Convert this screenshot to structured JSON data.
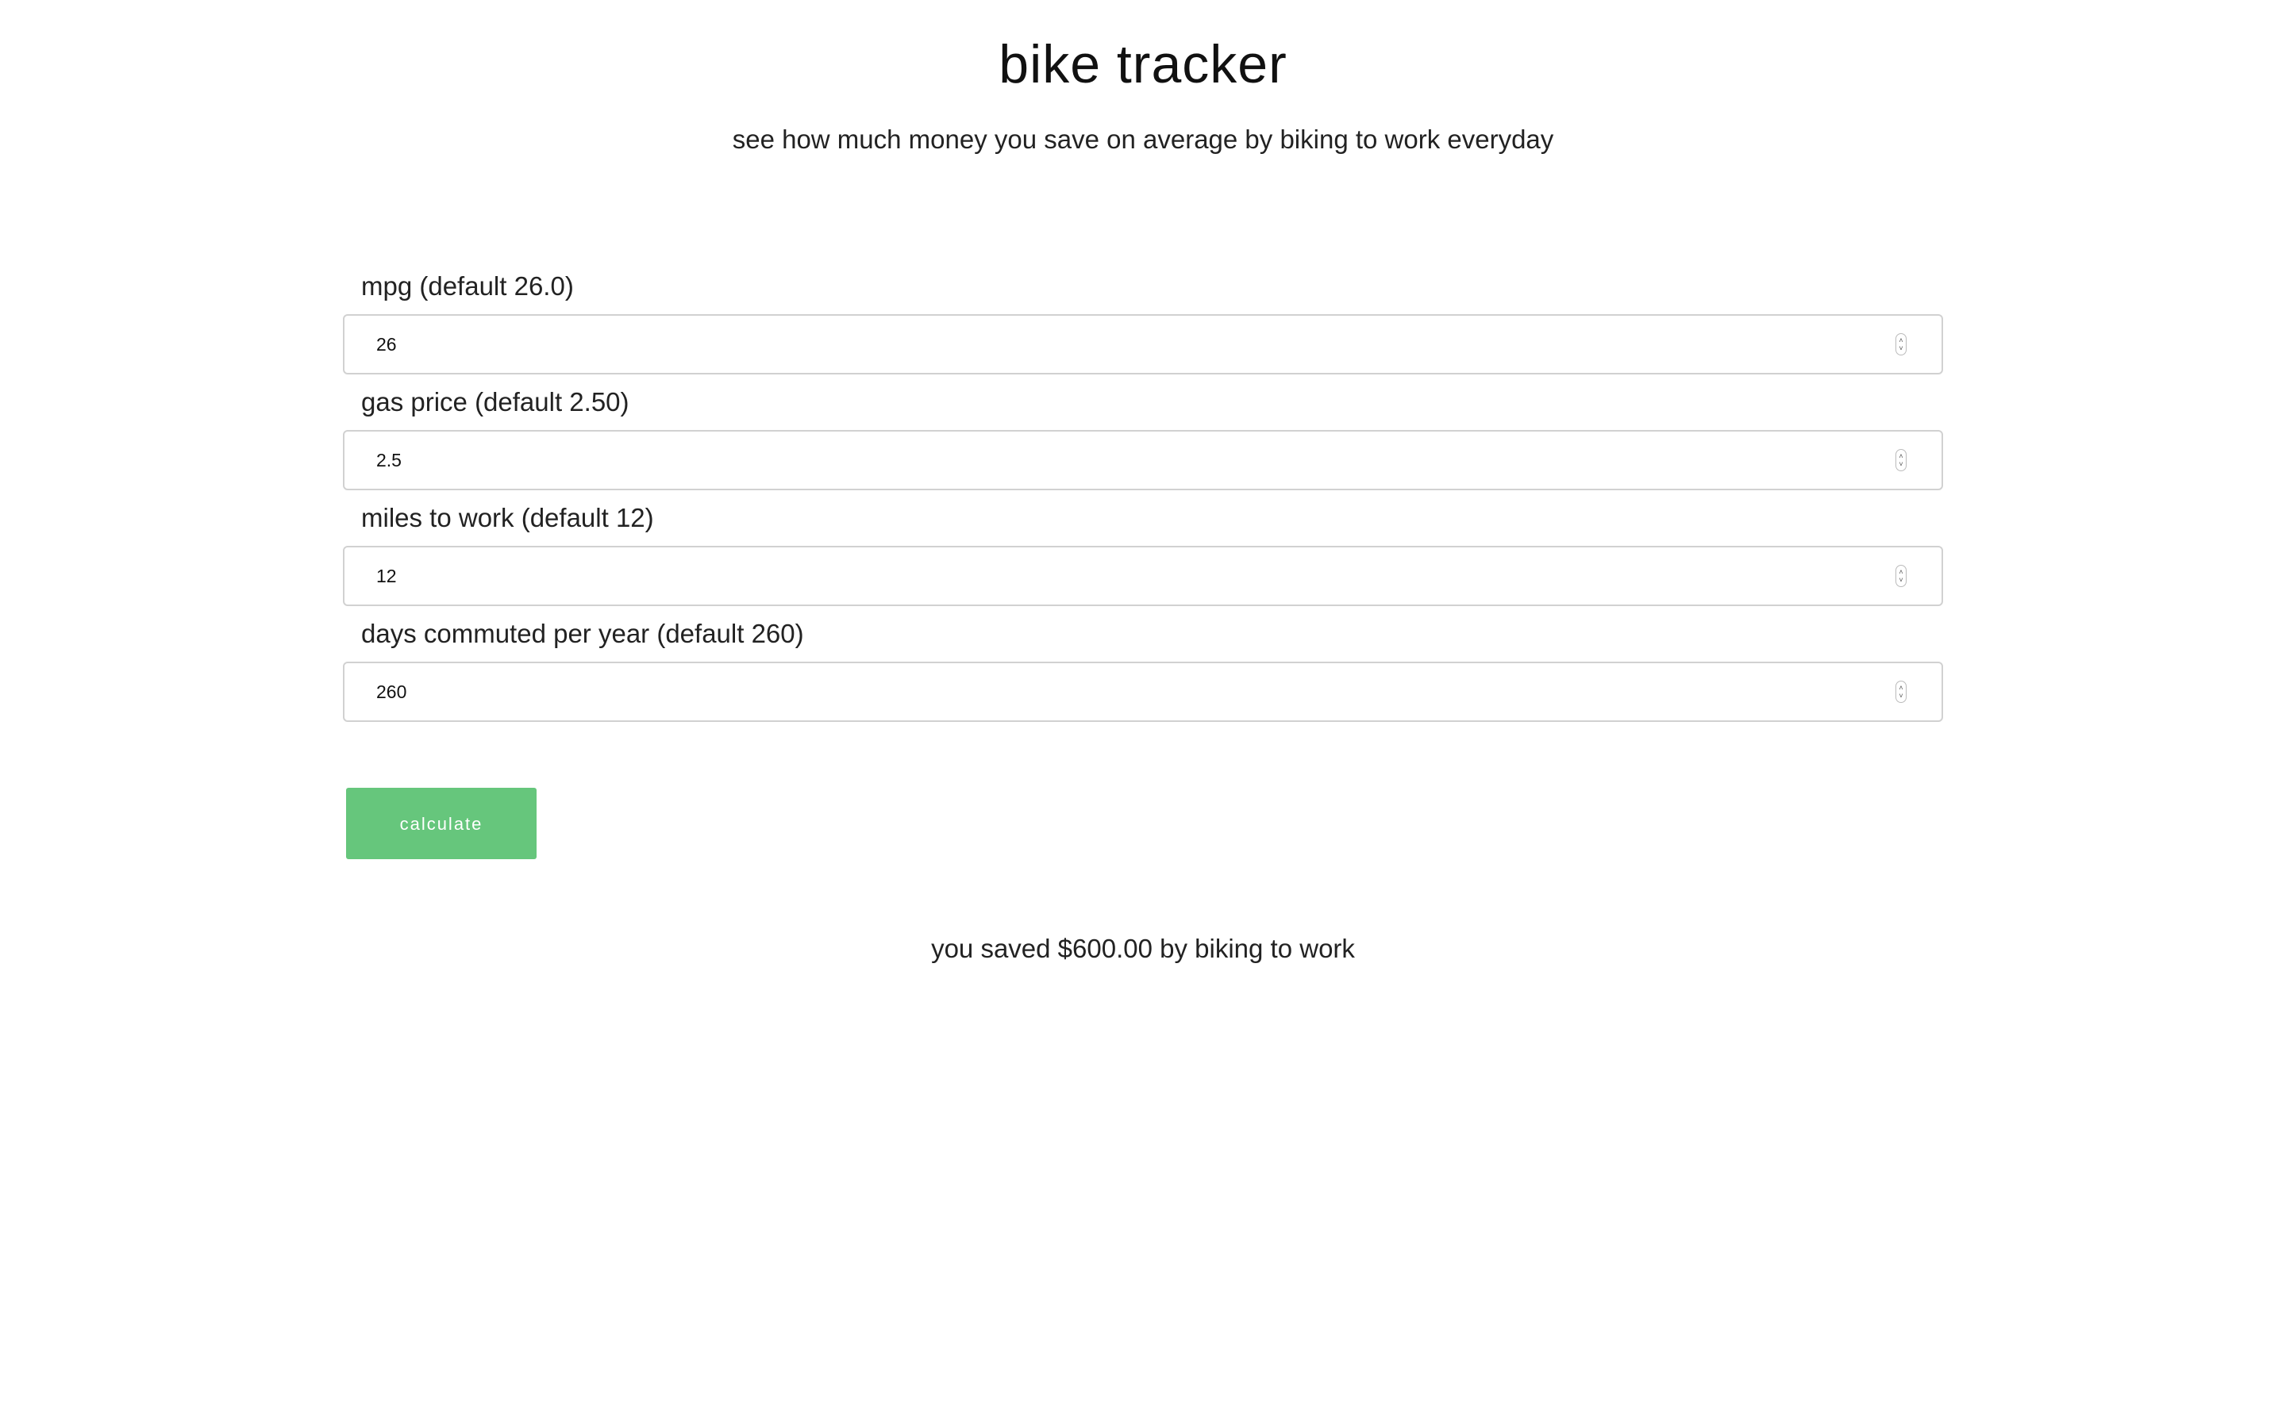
{
  "header": {
    "title": "bike tracker",
    "subtitle": "see how much money you save on average by biking to work everyday"
  },
  "form": {
    "fields": [
      {
        "label": "mpg (default 26.0)",
        "value": "26"
      },
      {
        "label": "gas price (default 2.50)",
        "value": "2.5"
      },
      {
        "label": "miles to work (default 12)",
        "value": "12"
      },
      {
        "label": "days commuted per year (default 260)",
        "value": "260"
      }
    ],
    "spinner_up_glyph": "˄",
    "spinner_down_glyph": "˅",
    "calculate_label": "calculate"
  },
  "result": {
    "text": "you saved $600.00 by biking to work"
  },
  "colors": {
    "button_bg": "#66c67c",
    "button_text": "#ffffff",
    "input_border": "#d1d1d1"
  }
}
